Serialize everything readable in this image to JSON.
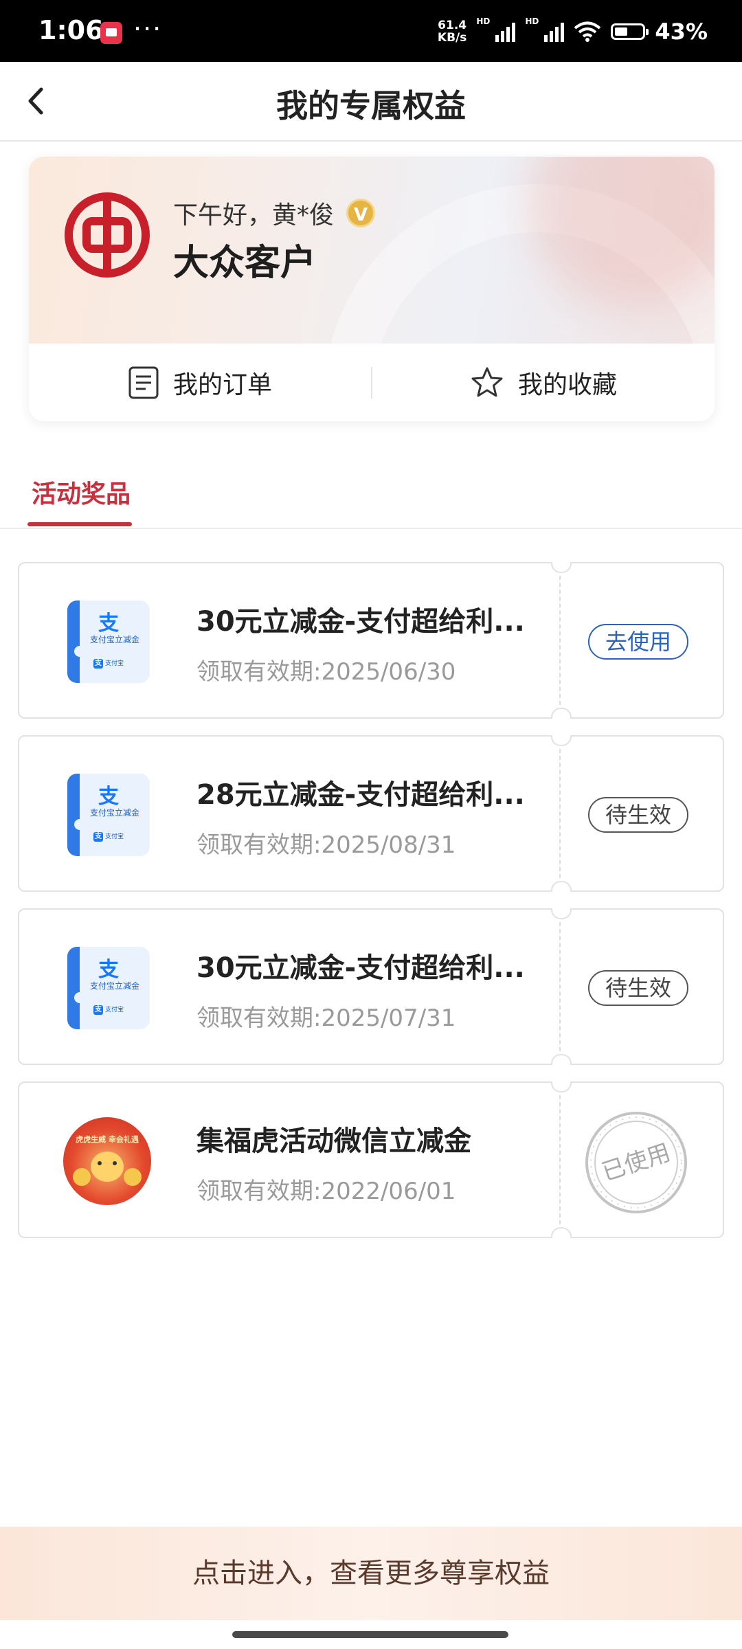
{
  "status_bar": {
    "time": "1:06",
    "dots": "···",
    "speed_value": "61.4",
    "speed_unit": "KB/s",
    "hd1": "HD",
    "hd2": "HD",
    "battery": "43%"
  },
  "nav": {
    "title": "我的专属权益"
  },
  "member_card": {
    "greeting": "下午好，黄*俊",
    "badge": "V",
    "level": "大众客户",
    "actions": [
      {
        "label": "我的订单",
        "icon": "order-list-icon"
      },
      {
        "label": "我的收藏",
        "icon": "star-icon"
      }
    ]
  },
  "tabs": [
    {
      "label": "活动奖品",
      "active": true
    }
  ],
  "coupons": [
    {
      "title": "30元立减金-支付超给利...",
      "date": "领取有效期:2025/06/30",
      "status": "去使用",
      "status_style": "blue",
      "thumb": {
        "glyph": "支",
        "line": "支付宝立减金",
        "foot_mark": "支",
        "foot": "支付宝"
      }
    },
    {
      "title": "28元立减金-支付超给利...",
      "date": "领取有效期:2025/08/31",
      "status": "待生效",
      "status_style": "gray",
      "thumb": {
        "glyph": "支",
        "line": "支付宝立减金",
        "foot_mark": "支",
        "foot": "支付宝"
      }
    },
    {
      "title": "30元立减金-支付超给利...",
      "date": "领取有效期:2025/07/31",
      "status": "待生效",
      "status_style": "gray",
      "thumb": {
        "glyph": "支",
        "line": "支付宝立减金",
        "foot_mark": "支",
        "foot": "支付宝"
      }
    },
    {
      "title": "集福虎活动微信立减金",
      "date": "领取有效期:2022/06/01",
      "status": "已使用",
      "status_style": "stamp",
      "thumb": {
        "banner": "虎虎生威 幸会礼遇"
      }
    }
  ],
  "bottom_banner": "点击进入，查看更多尊享权益",
  "colors": {
    "accent_red": "#c8303e",
    "link_blue": "#2a63b8",
    "boc_red": "#c8202a"
  }
}
